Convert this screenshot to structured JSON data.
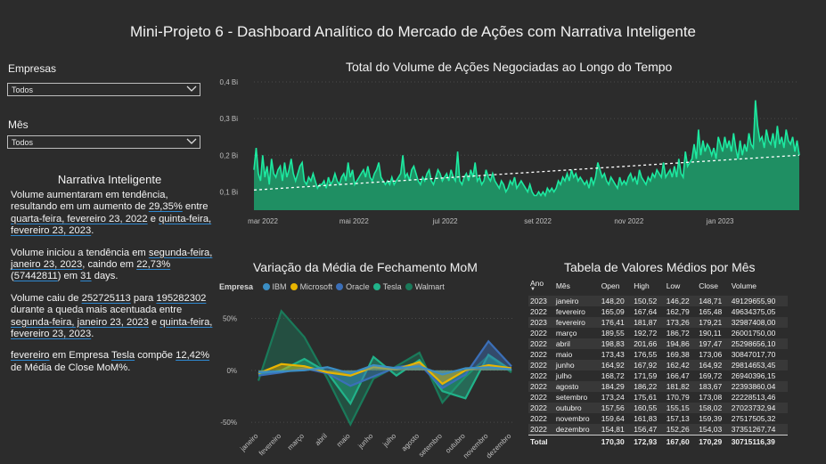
{
  "page_title": "Mini-Projeto 6 - Dashboard Analítico do Mercado de Ações com Narrativa Inteligente",
  "filters": {
    "empresas": {
      "label": "Empresas",
      "value": "Todos"
    },
    "mes": {
      "label": "Mês",
      "value": "Todos"
    }
  },
  "narrative": {
    "title": "Narrativa Inteligente",
    "p1": {
      "t1": "Volume aumentaram em tendência, resultando em um aumento de ",
      "h1": "29,35%",
      "t2": " entre ",
      "h2": "quarta-feira, fevereiro 23, 2022",
      "t3": " e ",
      "h3": "quinta-feira, fevereiro 23, 2023",
      "t4": "."
    },
    "p2": {
      "t1": "Volume iniciou a tendência em ",
      "h1": "segunda-feira, janeiro 23, 2023",
      "t2": ", caindo em ",
      "h2": "22,73%",
      "t3": " (",
      "h3": "57442811",
      "t4": ") em ",
      "h4": "31",
      "t5": " days."
    },
    "p3": {
      "t1": "Volume caiu de ",
      "h1": "252725113",
      "t2": " para ",
      "h2": "195282302",
      "t3": " durante a queda mais acentuada entre ",
      "h3": "segunda-feira, janeiro 23, 2023",
      "t4": " e ",
      "h4": "quinta-feira, fevereiro 23, 2023",
      "t5": "."
    },
    "p4": {
      "h1": "fevereiro",
      "t1": " em Empresa ",
      "h2": "Tesla",
      "t2": " compõe ",
      "h3": "12,42%",
      "t3": " de Média de Close MoM%."
    }
  },
  "volume_chart": {
    "title": "Total do Volume de Ações Negociadas ao Longo do Tempo",
    "y_ticks": [
      "0,4 Bi",
      "0,3 Bi",
      "0,2 Bi",
      "0,1 Bi"
    ],
    "x_ticks": [
      "mar 2022",
      "mai 2022",
      "jul 2022",
      "set 2022",
      "nov 2022",
      "jan 2023"
    ],
    "line_color": "#1de9a0",
    "area_color": "#1f8f63"
  },
  "mom_chart": {
    "title": "Variação da Média de Fechamento MoM",
    "legend_label": "Empresa",
    "y_ticks": [
      "50%",
      "0%",
      "-50%"
    ],
    "months": [
      "janeiro",
      "fevereiro",
      "março",
      "abril",
      "maio",
      "junho",
      "julho",
      "agosto",
      "setembro",
      "outubro",
      "novembro",
      "dezembro"
    ]
  },
  "table": {
    "title": "Tabela de Valores Médios por Mês",
    "headers": [
      "Ano",
      "Mês",
      "Open",
      "High",
      "Low",
      "Close",
      "Volume"
    ],
    "rows": [
      [
        "2023",
        "janeiro",
        "148,20",
        "150,52",
        "146,22",
        "148,71",
        "49129655,90"
      ],
      [
        "2022",
        "fevereiro",
        "165,09",
        "167,64",
        "162,79",
        "165,48",
        "49634375,05"
      ],
      [
        "2023",
        "fevereiro",
        "176,41",
        "181,87",
        "173,26",
        "179,21",
        "32987408,00"
      ],
      [
        "2022",
        "março",
        "189,55",
        "192,72",
        "186,72",
        "190,11",
        "26001750,00"
      ],
      [
        "2022",
        "abril",
        "198,83",
        "201,66",
        "194,86",
        "197,47",
        "25298656,10"
      ],
      [
        "2022",
        "maio",
        "173,43",
        "176,55",
        "169,38",
        "173,06",
        "30847017,70"
      ],
      [
        "2022",
        "junho",
        "164,92",
        "167,92",
        "162,42",
        "164,92",
        "29814653,45"
      ],
      [
        "2022",
        "julho",
        "168,72",
        "171,59",
        "166,47",
        "169,72",
        "26940396,15"
      ],
      [
        "2022",
        "agosto",
        "184,29",
        "186,22",
        "181,82",
        "183,67",
        "22393860,04"
      ],
      [
        "2022",
        "setembro",
        "173,24",
        "175,61",
        "170,79",
        "173,08",
        "22228513,46"
      ],
      [
        "2022",
        "outubro",
        "157,56",
        "160,55",
        "155,15",
        "158,02",
        "27023732,94"
      ],
      [
        "2022",
        "novembro",
        "159,64",
        "161,83",
        "157,13",
        "159,39",
        "27517505,32"
      ],
      [
        "2022",
        "dezembro",
        "154,81",
        "156,47",
        "152,26",
        "154,03",
        "37351267,74"
      ]
    ],
    "total": [
      "Total",
      "",
      "170,30",
      "172,93",
      "167,60",
      "170,29",
      "30715116,39"
    ]
  },
  "chart_data": [
    {
      "type": "area",
      "title": "Total do Volume de Ações Negociadas ao Longo do Tempo",
      "xlabel": "",
      "ylabel": "",
      "ylim": [
        0.05,
        0.4
      ],
      "y_unit": "Bi",
      "x_start": "2022-02-23",
      "x_end": "2023-02-23",
      "x_ticks": [
        "mar 2022",
        "mai 2022",
        "jul 2022",
        "set 2022",
        "nov 2022",
        "jan 2023"
      ],
      "trendline": {
        "start": 0.105,
        "end": 0.2
      },
      "values": [
        0.16,
        0.22,
        0.15,
        0.13,
        0.2,
        0.14,
        0.17,
        0.12,
        0.19,
        0.15,
        0.14,
        0.16,
        0.17,
        0.13,
        0.18,
        0.14,
        0.16,
        0.19,
        0.15,
        0.13,
        0.15,
        0.17,
        0.18,
        0.13,
        0.12,
        0.14,
        0.13,
        0.15,
        0.13,
        0.11,
        0.12,
        0.12,
        0.13,
        0.11,
        0.14,
        0.12,
        0.13,
        0.15,
        0.13,
        0.12,
        0.14,
        0.15,
        0.13,
        0.18,
        0.14,
        0.16,
        0.12,
        0.13,
        0.14,
        0.15,
        0.16,
        0.14,
        0.17,
        0.14,
        0.13,
        0.15,
        0.16,
        0.18,
        0.14,
        0.13,
        0.12,
        0.13,
        0.12,
        0.14,
        0.12,
        0.13,
        0.14,
        0.15,
        0.2,
        0.14,
        0.15,
        0.13,
        0.16,
        0.17,
        0.15,
        0.13,
        0.12,
        0.14,
        0.13,
        0.15,
        0.16,
        0.13,
        0.12,
        0.14,
        0.16,
        0.15,
        0.13,
        0.14,
        0.15,
        0.13,
        0.16,
        0.14,
        0.13,
        0.21,
        0.13,
        0.12,
        0.14,
        0.15,
        0.13,
        0.16,
        0.14,
        0.18,
        0.13,
        0.14,
        0.12,
        0.13,
        0.16,
        0.14,
        0.13,
        0.15,
        0.13,
        0.12,
        0.11,
        0.13,
        0.12,
        0.1,
        0.11,
        0.13,
        0.12,
        0.14,
        0.11,
        0.12,
        0.13,
        0.12,
        0.11,
        0.1,
        0.12,
        0.1,
        0.09,
        0.09,
        0.1,
        0.09,
        0.1,
        0.09,
        0.11,
        0.1,
        0.11,
        0.1,
        0.11,
        0.13,
        0.12,
        0.14,
        0.13,
        0.15,
        0.13,
        0.16,
        0.14,
        0.15,
        0.13,
        0.14,
        0.13,
        0.12,
        0.13,
        0.11,
        0.14,
        0.12,
        0.14,
        0.18,
        0.16,
        0.14,
        0.15,
        0.13,
        0.12,
        0.14,
        0.13,
        0.12,
        0.11,
        0.14,
        0.12,
        0.13,
        0.12,
        0.14,
        0.15,
        0.13,
        0.14,
        0.12,
        0.16,
        0.14,
        0.13,
        0.12,
        0.14,
        0.13,
        0.15,
        0.14,
        0.16,
        0.15,
        0.14,
        0.18,
        0.14,
        0.15,
        0.16,
        0.14,
        0.17,
        0.14,
        0.19,
        0.15,
        0.14,
        0.21,
        0.17,
        0.18,
        0.19,
        0.23,
        0.19,
        0.27,
        0.2,
        0.24,
        0.21,
        0.23,
        0.22,
        0.2,
        0.22,
        0.19,
        0.25,
        0.23,
        0.21,
        0.25,
        0.22,
        0.24,
        0.21,
        0.26,
        0.22,
        0.19,
        0.24,
        0.2,
        0.23,
        0.21,
        0.26,
        0.23,
        0.22,
        0.35,
        0.28,
        0.24,
        0.25,
        0.22,
        0.27,
        0.24,
        0.23,
        0.26,
        0.22,
        0.28,
        0.23,
        0.25,
        0.22,
        0.27,
        0.24,
        0.23,
        0.25,
        0.21,
        0.24,
        0.2
      ]
    },
    {
      "type": "area",
      "title": "Variação da Média de Fechamento MoM",
      "xlabel": "",
      "ylabel": "",
      "ylim": [
        -0.55,
        0.65
      ],
      "categories": [
        "janeiro",
        "fevereiro",
        "março",
        "abril",
        "maio",
        "junho",
        "julho",
        "agosto",
        "setembro",
        "outubro",
        "novembro",
        "dezembro"
      ],
      "legend_position": "top-left",
      "series": [
        {
          "name": "IBM",
          "color": "#3b8ec4",
          "values": [
            -0.02,
            -0.01,
            0.0,
            0.03,
            -0.03,
            0.05,
            0.02,
            0.04,
            -0.04,
            0.02,
            0.03,
            0.01
          ]
        },
        {
          "name": "Microsoft",
          "color": "#e8b400",
          "values": [
            -0.03,
            0.06,
            0.04,
            -0.02,
            -0.05,
            0.03,
            0.01,
            0.08,
            -0.13,
            0.0,
            0.05,
            0.02
          ]
        },
        {
          "name": "Oracle",
          "color": "#3b6fb8",
          "values": [
            -0.05,
            -0.02,
            0.02,
            -0.03,
            -0.15,
            -0.06,
            0.03,
            0.06,
            -0.17,
            -0.04,
            0.28,
            0.04
          ]
        },
        {
          "name": "Tesla",
          "color": "#21b38a",
          "values": [
            -0.04,
            0.0,
            0.11,
            -0.02,
            -0.32,
            0.13,
            -0.05,
            0.1,
            -0.2,
            -0.27,
            0.15,
            0.0
          ]
        },
        {
          "name": "Walmart",
          "color": "#1a7a5a",
          "values": [
            -0.1,
            0.57,
            0.32,
            -0.08,
            -0.52,
            -0.08,
            0.04,
            0.17,
            -0.31,
            -0.06,
            0.14,
            -0.02
          ]
        }
      ]
    },
    {
      "type": "table",
      "title": "Tabela de Valores Médios por Mês"
    }
  ]
}
